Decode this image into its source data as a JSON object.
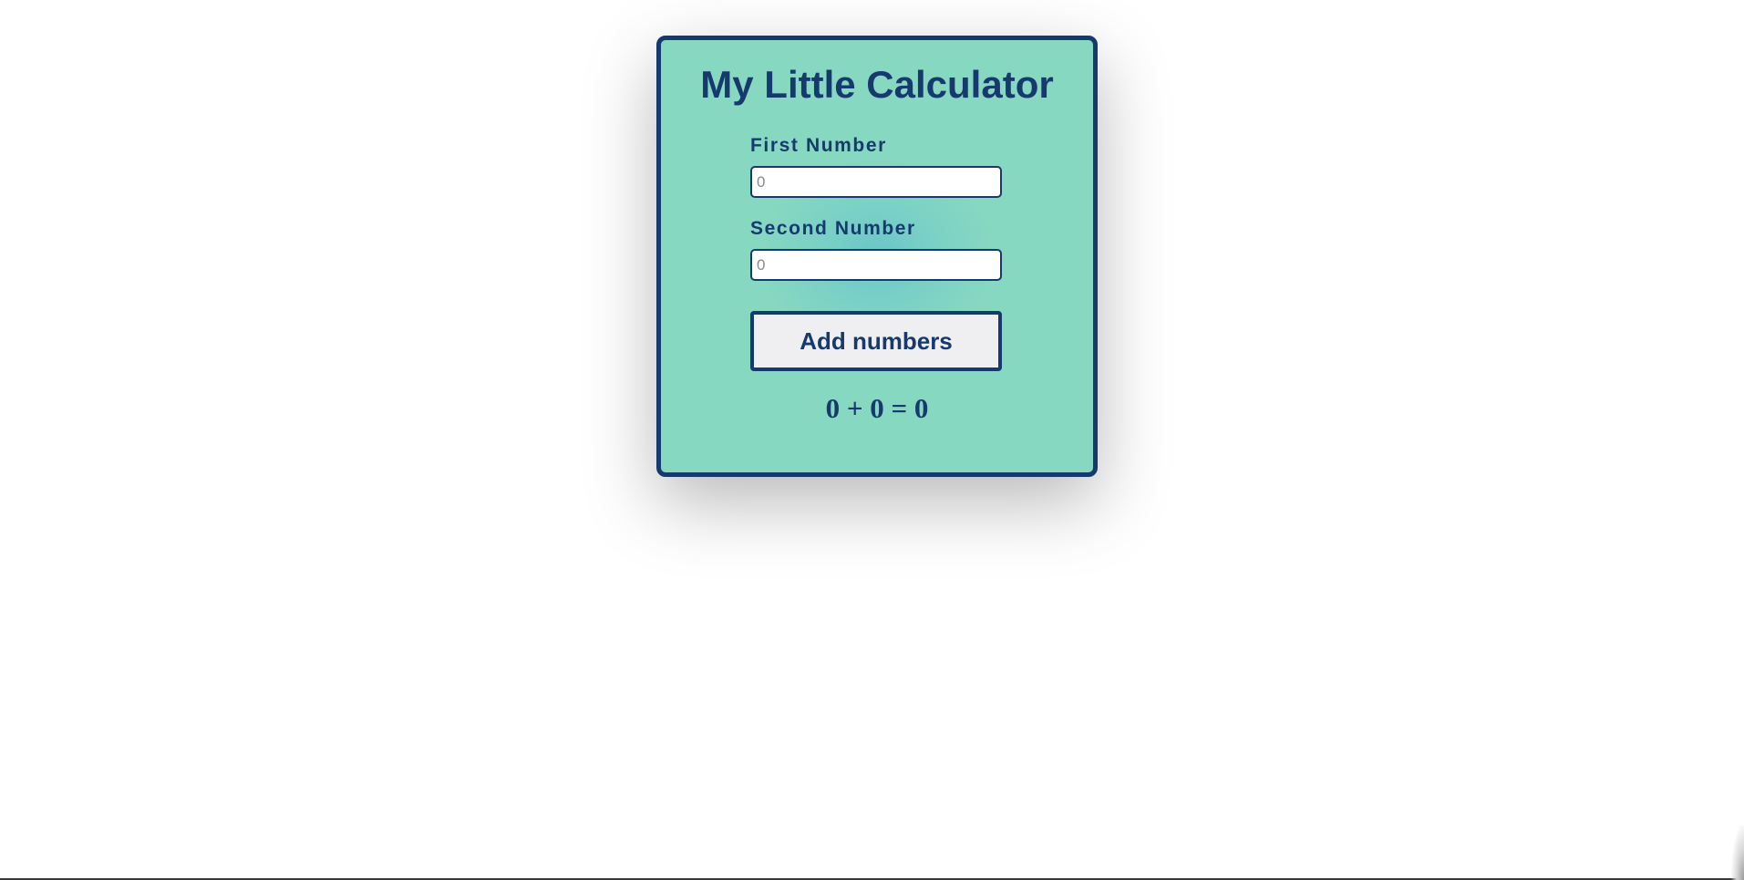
{
  "app": {
    "title": "My Little Calculator"
  },
  "form": {
    "first": {
      "label": "First Number",
      "value": "",
      "placeholder": "0"
    },
    "second": {
      "label": "Second Number",
      "value": "",
      "placeholder": "0"
    },
    "submit_label": "Add numbers"
  },
  "result": {
    "text": "0 + 0 = 0"
  },
  "colors": {
    "primary": "#163a6e",
    "card_background": "#87d8c1",
    "card_center": "#6ac5c9",
    "button_background": "#efeff1",
    "page_background": "#ffffff"
  }
}
